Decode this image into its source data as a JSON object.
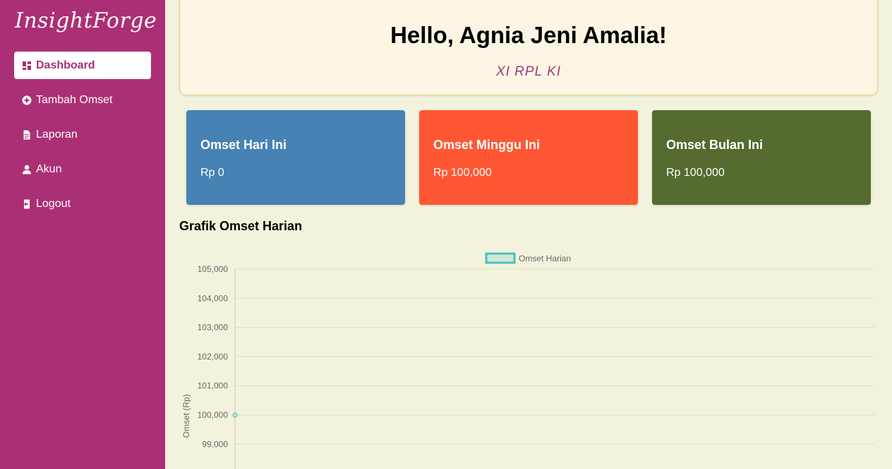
{
  "app": {
    "brand": "InsightForge"
  },
  "sidebar": {
    "items": [
      {
        "label": "Dashboard",
        "icon": "dashboard-icon",
        "active": true
      },
      {
        "label": "Tambah Omset",
        "icon": "plus-circle-icon",
        "active": false
      },
      {
        "label": "Laporan",
        "icon": "file-icon",
        "active": false
      },
      {
        "label": "Akun",
        "icon": "user-icon",
        "active": false
      },
      {
        "label": "Logout",
        "icon": "logout-icon",
        "active": false
      }
    ]
  },
  "welcome": {
    "greeting": "Hello, Agnia Jeni Amalia!",
    "class_name": "XI RPL KI"
  },
  "cards": [
    {
      "title": "Omset Hari Ini",
      "value": "Rp 0",
      "color": "#4682b4"
    },
    {
      "title": "Omset Minggu Ini",
      "value": "Rp 100,000",
      "color": "#ff5733"
    },
    {
      "title": "Omset Bulan Ini",
      "value": "Rp 100,000",
      "color": "#556b2f"
    }
  ],
  "chart_section": {
    "heading": "Grafik Omset Harian"
  },
  "chart_data": {
    "type": "line",
    "legend_position": "top",
    "ylabel": "Omset (Rp)",
    "xlabel": "",
    "ylim": [
      98700,
      105000
    ],
    "yticks": [
      "105,000",
      "104,000",
      "103,000",
      "102,000",
      "101,000",
      "100,000",
      "99,000"
    ],
    "ytick_values": [
      105000,
      104000,
      103000,
      102000,
      101000,
      100000,
      99000
    ],
    "grid": true,
    "series": [
      {
        "name": "Omset Harian",
        "values": [
          100000
        ],
        "color": "#4bc0c0"
      }
    ]
  }
}
